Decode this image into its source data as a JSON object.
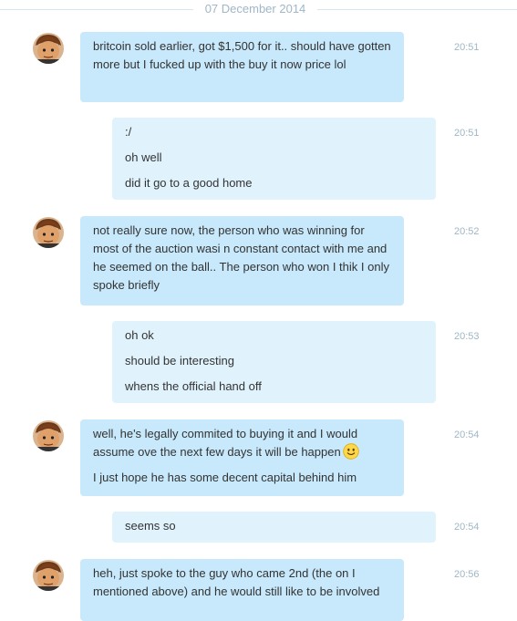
{
  "date_separator": "07 December 2014",
  "messages": [
    {
      "from": "them",
      "time": "20:51",
      "lines": [
        "britcoin sold earlier, got $1,500 for it..  should have gotten more but I fucked up with the buy it now price lol"
      ]
    },
    {
      "from": "me",
      "time": "20:51",
      "lines": [
        ":/",
        "oh well",
        "did it go to a good home"
      ]
    },
    {
      "from": "them",
      "time": "20:52",
      "lines": [
        "not really sure now, the person who was winning for most of the auction wasi n constant contact with me and he seemed on the ball..  The person who won I thik I only spoke briefly"
      ]
    },
    {
      "from": "me",
      "time": "20:53",
      "lines": [
        "oh ok",
        "should be interesting",
        "whens the official hand off"
      ]
    },
    {
      "from": "them",
      "time": "20:54",
      "lines": [
        "well, he's legally commited to buying it and I would assume ove the next few days it will be happen",
        "I just hope he has some decent capital behind him"
      ],
      "emoji": "smile-emoji"
    },
    {
      "from": "me",
      "time": "20:54",
      "lines": [
        "seems so"
      ]
    },
    {
      "from": "them",
      "time": "20:56",
      "lines": [
        "heh, just spoke to the guy who came 2nd (the on I mentioned above) and he would still like to be involved"
      ]
    }
  ],
  "colors": {
    "incoming_bubble": "#c7e9fb",
    "outgoing_bubble": "#e0f3fd",
    "timestamp": "#9fb7c6"
  }
}
